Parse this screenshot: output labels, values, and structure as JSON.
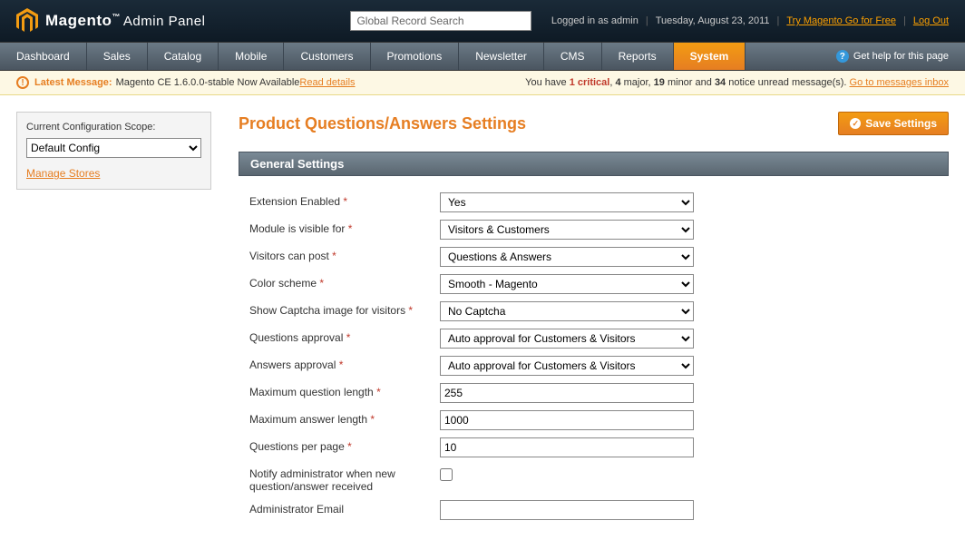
{
  "header": {
    "brand": "Magento",
    "tm": "™",
    "subtitle": "Admin Panel",
    "search_placeholder": "Global Record Search",
    "logged_in": "Logged in as admin",
    "date": "Tuesday, August 23, 2011",
    "try_link": "Try Magento Go for Free",
    "logout": "Log Out"
  },
  "nav": {
    "items": [
      "Dashboard",
      "Sales",
      "Catalog",
      "Mobile",
      "Customers",
      "Promotions",
      "Newsletter",
      "CMS",
      "Reports",
      "System"
    ],
    "help": "Get help for this page"
  },
  "msg": {
    "latest_label": "Latest Message:",
    "latest_text": "Magento CE 1.6.0.0-stable Now Available ",
    "read_details": "Read details",
    "you_have": "You have ",
    "critical": "1 critical",
    "major_n": "4",
    "major_t": " major, ",
    "minor_n": "19",
    "minor_t": " minor and ",
    "notice_n": "34",
    "notice_t": " notice unread message(s). ",
    "inbox": "Go to messages inbox"
  },
  "sidebar": {
    "scope_label": "Current Configuration Scope:",
    "scope_value": "Default Config",
    "manage_stores": "Manage Stores"
  },
  "page": {
    "title": "Product Questions/Answers Settings",
    "save": "Save Settings"
  },
  "section": {
    "title": "General Settings"
  },
  "form": {
    "ext_enabled_l": "Extension Enabled ",
    "ext_enabled_v": "Yes",
    "visible_l": "Module is visible for ",
    "visible_v": "Visitors & Customers",
    "post_l": "Visitors can post ",
    "post_v": "Questions & Answers",
    "color_l": "Color scheme ",
    "color_v": "Smooth - Magento",
    "captcha_l": "Show Captcha image for visitors ",
    "captcha_v": "No Captcha",
    "q_approval_l": "Questions approval ",
    "q_approval_v": "Auto approval for Customers & Visitors",
    "a_approval_l": "Answers approval ",
    "a_approval_v": "Auto approval for Customers & Visitors",
    "max_q_l": "Maximum question length ",
    "max_q_v": "255",
    "max_a_l": "Maximum answer length ",
    "max_a_v": "1000",
    "per_page_l": "Questions per page ",
    "per_page_v": "10",
    "notify_l": "Notify administrator when new question/answer received",
    "admin_email_l": "Administrator Email",
    "admin_email_v": ""
  }
}
